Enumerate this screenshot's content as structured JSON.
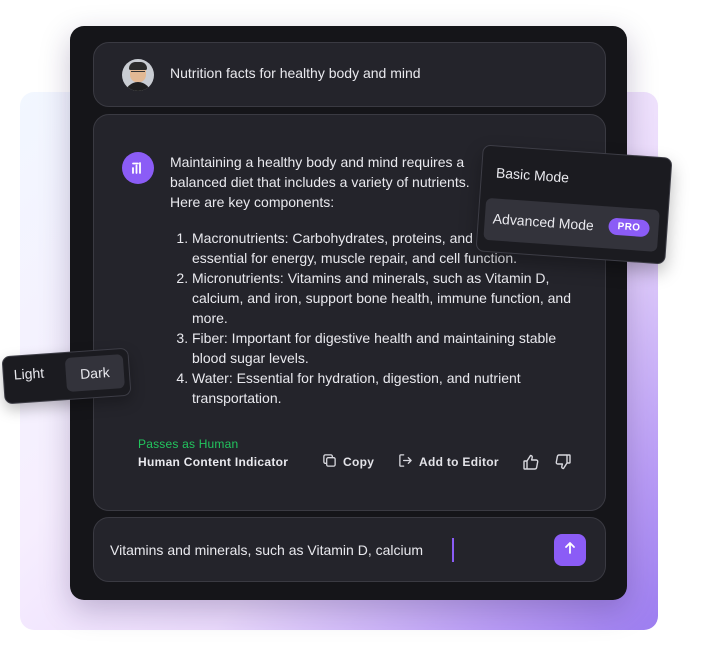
{
  "prompt": {
    "text": "Nutrition facts for healthy body and mind"
  },
  "answer": {
    "intro": "Maintaining a healthy body and mind requires a balanced diet that includes a variety of nutrients. Here are key components:",
    "items": [
      "Macronutrients: Carbohydrates, proteins, and fats are essential for energy, muscle repair, and cell function.",
      "Micronutrients: Vitamins and minerals, such as Vitamin D, calcium, and iron, support bone health, immune function, and more.",
      "Fiber: Important for digestive health and maintaining stable blood sugar levels.",
      "Water: Essential for hydration, digestion, and nutrient transportation."
    ],
    "status": "Passes as Human",
    "indicator_label": "Human Content Indicator",
    "copy_label": "Copy",
    "editor_label": "Add to Editor"
  },
  "input": {
    "value": "Vitamins and minerals, such as Vitamin D, calcium"
  },
  "theme_toggle": {
    "light_label": "Light",
    "dark_label": "Dark",
    "selected": "Dark"
  },
  "mode_menu": {
    "basic_label": "Basic Mode",
    "advanced_label": "Advanced Mode",
    "badge": "PRO",
    "selected": "Advanced Mode"
  },
  "icons": {
    "ai": "ai-logo-icon",
    "copy": "copy-icon",
    "editor": "add-to-editor-icon",
    "thumb_up": "thumbs-up-icon",
    "thumb_down": "thumbs-down-icon",
    "send": "arrow-up-icon"
  },
  "colors": {
    "accent": "#8b5cf6",
    "success": "#22c55e",
    "panel": "#151519",
    "card": "#24242b"
  }
}
